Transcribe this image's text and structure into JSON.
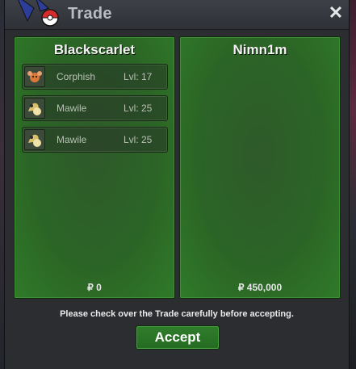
{
  "window": {
    "title": "Trade",
    "close_glyph": "✕"
  },
  "left_panel": {
    "player": "Blackscarlet",
    "items": [
      {
        "name": "Corphish",
        "level": "Lvl: 17",
        "icon": "corphish-sprite-icon"
      },
      {
        "name": "Mawile",
        "level": "Lvl: 25",
        "icon": "mawile-sprite-icon"
      },
      {
        "name": "Mawile",
        "level": "Lvl: 25",
        "icon": "mawile-sprite-icon"
      }
    ],
    "money": "₽ 0"
  },
  "right_panel": {
    "player": "Nimn1m",
    "items": [],
    "money": "₽ 450,000"
  },
  "footer": {
    "notice": "Please check over the Trade carefully before accepting.",
    "accept_label": "Accept"
  },
  "colors": {
    "panel_green": "#2b6426",
    "accent_green": "#2f7d2b",
    "title_text": "#b9bcc3"
  }
}
